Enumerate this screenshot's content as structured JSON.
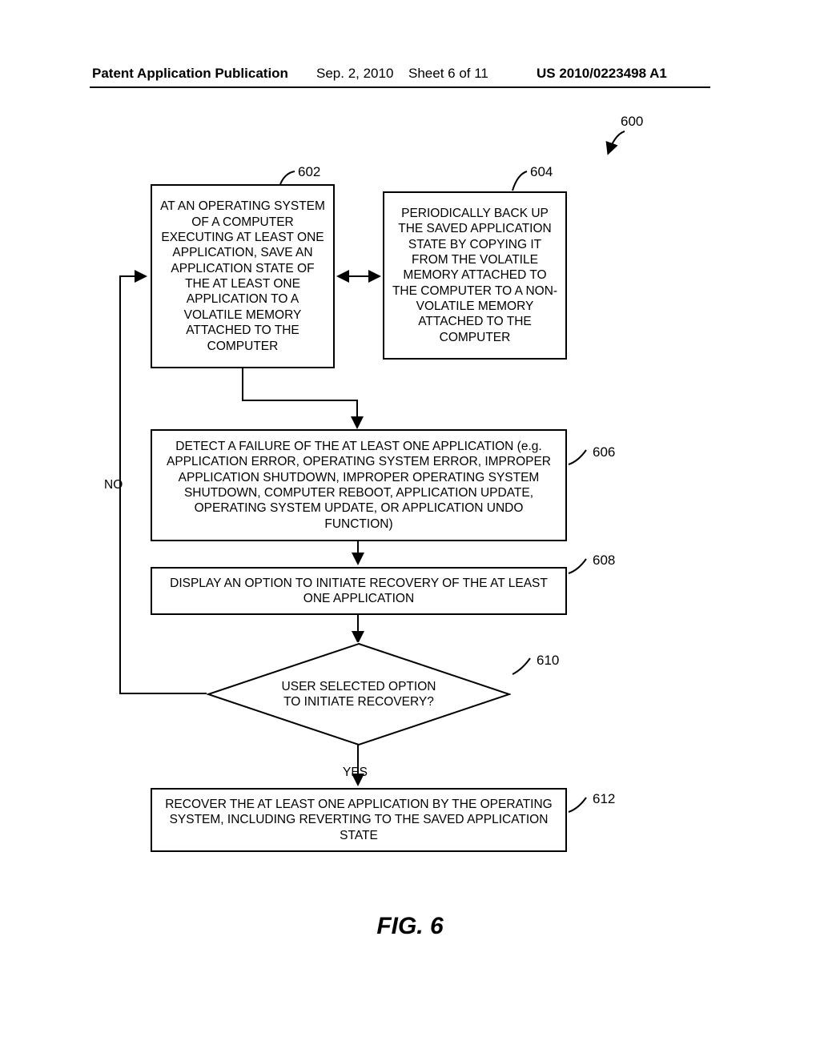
{
  "header": {
    "publication": "Patent Application Publication",
    "date": "Sep. 2, 2010",
    "sheet": "Sheet 6 of 11",
    "number": "US 2010/0223498 A1"
  },
  "figure_label": "FIG. 6",
  "refs": {
    "r600": "600",
    "r602": "602",
    "r604": "604",
    "r606": "606",
    "r608": "608",
    "r610": "610",
    "r612": "612"
  },
  "boxes": {
    "b602": "AT AN OPERATING SYSTEM OF A COMPUTER EXECUTING AT LEAST ONE APPLICATION, SAVE AN APPLICATION STATE OF THE AT LEAST ONE APPLICATION TO A VOLATILE MEMORY ATTACHED TO THE COMPUTER",
    "b604": "PERIODICALLY BACK UP THE SAVED APPLICATION STATE BY COPYING IT FROM THE VOLATILE MEMORY ATTACHED TO THE COMPUTER TO A NON-VOLATILE MEMORY ATTACHED TO THE COMPUTER",
    "b606": "DETECT A FAILURE OF THE AT LEAST ONE APPLICATION (e.g. APPLICATION ERROR, OPERATING SYSTEM ERROR, IMPROPER APPLICATION SHUTDOWN, IMPROPER OPERATING SYSTEM SHUTDOWN, COMPUTER REBOOT, APPLICATION UPDATE, OPERATING SYSTEM UPDATE, OR APPLICATION UNDO FUNCTION)",
    "b608": "DISPLAY AN OPTION TO INITIATE RECOVERY OF THE AT LEAST ONE APPLICATION",
    "b612": "RECOVER THE AT LEAST ONE APPLICATION BY THE OPERATING SYSTEM, INCLUDING REVERTING TO THE SAVED APPLICATION STATE"
  },
  "decision": {
    "d610": "USER SELECTED OPTION\nTO INITIATE RECOVERY?"
  },
  "branch_labels": {
    "no": "NO",
    "yes": "YES"
  }
}
